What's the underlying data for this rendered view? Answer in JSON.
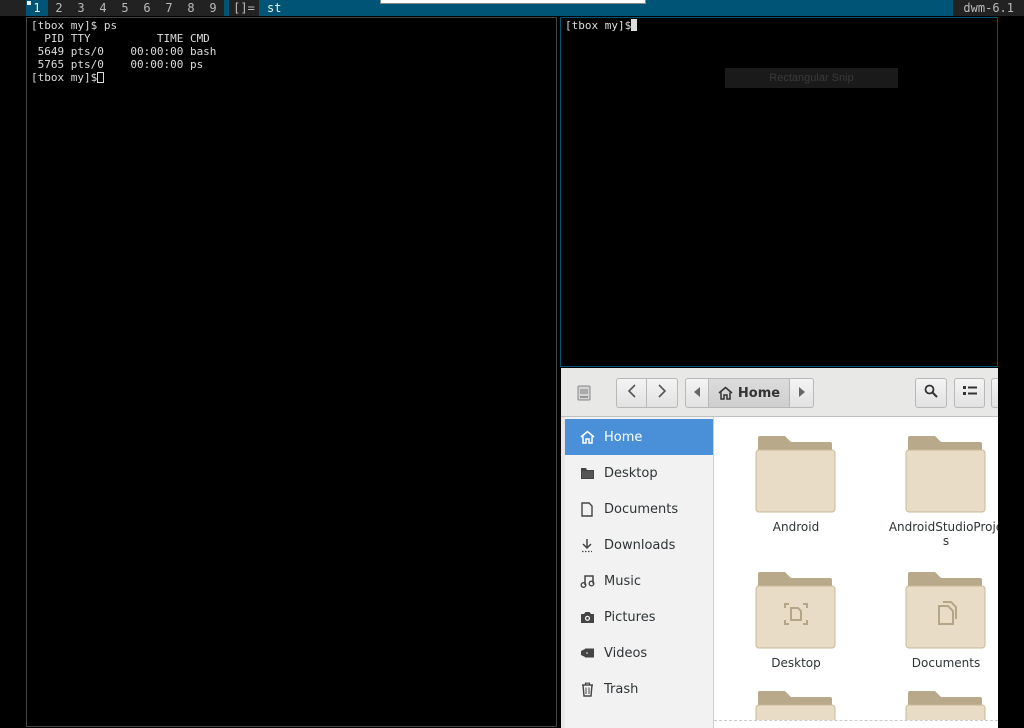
{
  "bar": {
    "tags": [
      "1",
      "2",
      "3",
      "4",
      "5",
      "6",
      "7",
      "8",
      "9"
    ],
    "layout": "[]=",
    "window_title": "st",
    "status": "dwm-6.1"
  },
  "term_left": {
    "lines": [
      "[tbox my]$ ps",
      "  PID TTY          TIME CMD",
      " 5649 pts/0    00:00:00 bash",
      " 5765 pts/0    00:00:00 ps"
    ],
    "prompt": "[tbox my]$"
  },
  "term_right": {
    "prompt": "[tbox my]$"
  },
  "snip_overlay": "Rectangular Snip",
  "file_manager": {
    "location": "Home",
    "sidebar": [
      {
        "label": "Home",
        "icon": "home-icon",
        "selected": true
      },
      {
        "label": "Desktop",
        "icon": "desktop-icon"
      },
      {
        "label": "Documents",
        "icon": "document-icon"
      },
      {
        "label": "Downloads",
        "icon": "download-icon"
      },
      {
        "label": "Music",
        "icon": "music-icon"
      },
      {
        "label": "Pictures",
        "icon": "camera-icon"
      },
      {
        "label": "Videos",
        "icon": "video-icon"
      },
      {
        "label": "Trash",
        "icon": "trash-icon"
      }
    ],
    "folders": [
      {
        "name": "Android",
        "name2": ""
      },
      {
        "name": "AndroidStudioProje",
        "name2": "s"
      },
      {
        "name": "Desktop",
        "name2": ""
      },
      {
        "name": "Documents",
        "name2": ""
      }
    ]
  }
}
